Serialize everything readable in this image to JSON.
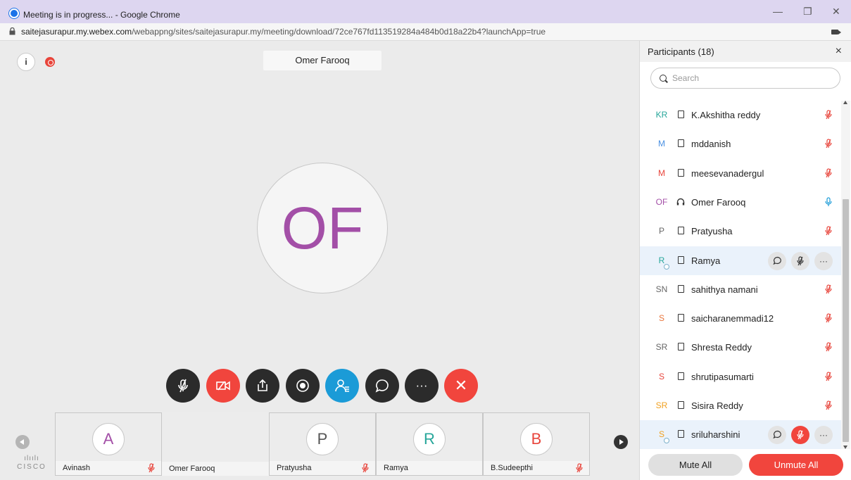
{
  "window": {
    "title": "Meeting is in progress... - Google Chrome",
    "minimize_glyph": "—",
    "restore_glyph": "❐",
    "close_glyph": "✕"
  },
  "address": {
    "url_host": "saitejasurapur.my.webex.com",
    "url_path": "/webappng/sites/saitejasurapur.my/meeting/download/72ce767fd113519284a484b0d18a22b4?launchApp=true"
  },
  "stage": {
    "info_glyph": "i",
    "speaker_name": "Omer Farooq",
    "speaker_initials": "OF",
    "speaker_color": "#a34fa7"
  },
  "controls": {
    "more_glyph": "···",
    "end_glyph": "✕"
  },
  "thumbnails": [
    {
      "initial": "A",
      "name": "Avinash",
      "color": "#a34fa7",
      "muted": true,
      "framed": true
    },
    {
      "initial": "",
      "name": "Omer Farooq",
      "color": "#333333",
      "muted": false,
      "framed": false
    },
    {
      "initial": "P",
      "name": "Pratyusha",
      "color": "#555555",
      "muted": true,
      "framed": true
    },
    {
      "initial": "R",
      "name": "Ramya",
      "color": "#26a69a",
      "muted": false,
      "framed": true
    },
    {
      "initial": "B",
      "name": "B.Sudeepthi",
      "color": "#e8453c",
      "muted": true,
      "framed": true
    }
  ],
  "cisco": {
    "bars": "ılıılı",
    "word": "CISCO"
  },
  "panel": {
    "title": "Participants (18)",
    "close_glyph": "×",
    "search_placeholder": "Search",
    "participants": [
      {
        "initials": "KR",
        "name": "K.Akshitha reddy",
        "color": "#26a69a",
        "device": "phone",
        "mute": "red"
      },
      {
        "initials": "M",
        "name": "mddanish",
        "color": "#4a90e2",
        "device": "phone",
        "mute": "red"
      },
      {
        "initials": "M",
        "name": "meesevanadergul",
        "color": "#e8453c",
        "device": "phone",
        "mute": "red"
      },
      {
        "initials": "OF",
        "name": "Omer Farooq",
        "color": "#a34fa7",
        "device": "headset",
        "mute": "blue"
      },
      {
        "initials": "P",
        "name": "Pratyusha",
        "color": "#666666",
        "device": "phone",
        "mute": "red"
      },
      {
        "initials": "R",
        "name": "Ramya",
        "color": "#26a69a",
        "device": "phone",
        "mute": "buttons",
        "status_dot": true,
        "hover": true
      },
      {
        "initials": "SN",
        "name": "sahithya namani",
        "color": "#666666",
        "device": "phone",
        "mute": "red"
      },
      {
        "initials": "S",
        "name": "saicharanemmadi12",
        "color": "#e8753c",
        "device": "phone",
        "mute": "red"
      },
      {
        "initials": "SR",
        "name": "Shresta Reddy",
        "color": "#666666",
        "device": "phone",
        "mute": "red"
      },
      {
        "initials": "S",
        "name": "shrutipasumarti",
        "color": "#e8453c",
        "device": "phone",
        "mute": "red"
      },
      {
        "initials": "SR",
        "name": "Sisira Reddy",
        "color": "#f0a020",
        "device": "phone",
        "mute": "red"
      },
      {
        "initials": "S",
        "name": "sriluharshini",
        "color": "#f0a020",
        "device": "phone",
        "mute": "buttons-red",
        "status_dot": true,
        "hover": true
      }
    ],
    "more_glyph": "···",
    "mute_all_label": "Mute All",
    "unmute_all_label": "Unmute All"
  },
  "colors": {
    "accent_red": "#f1453d",
    "accent_blue": "#1b9bd7",
    "control_dark": "#2b2b2b"
  }
}
